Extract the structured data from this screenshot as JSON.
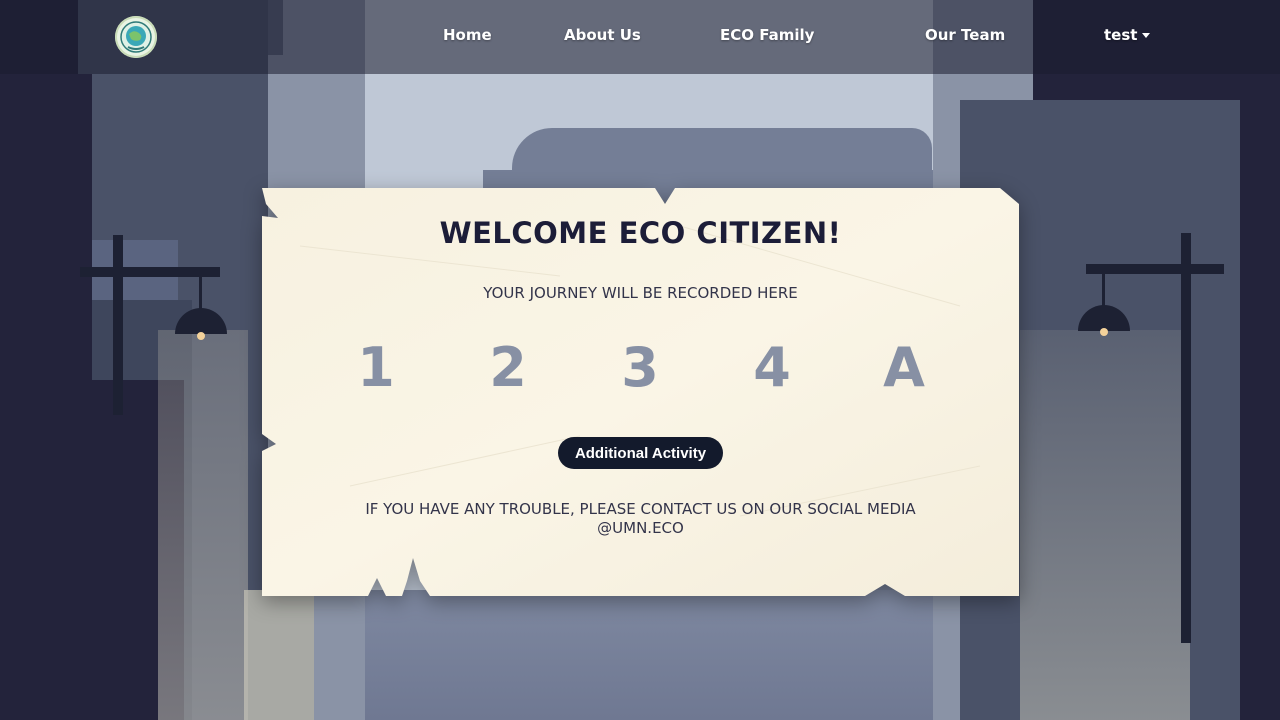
{
  "nav": {
    "logo_icon": "eco-globe-logo",
    "links": [
      "Home",
      "About Us",
      "ECO Family",
      "Our Team"
    ],
    "user_menu": "test"
  },
  "card": {
    "title": "WELCOME ECO CITIZEN!",
    "subtitle": "YOUR JOURNEY WILL BE RECORDED HERE",
    "steps": [
      "1",
      "2",
      "3",
      "4",
      "A"
    ],
    "button": "Additional Activity",
    "contact_line1": "IF YOU HAVE ANY TROUBLE, PLEASE CONTACT US ON OUR SOCIAL MEDIA",
    "contact_line2": "@UMN.ECO"
  },
  "colors": {
    "card_background": "#f8f2e2",
    "title": "#1c1d38",
    "step_numbers": "#8790a4",
    "button": "#131a2c",
    "sky": "#bfc8d6"
  }
}
